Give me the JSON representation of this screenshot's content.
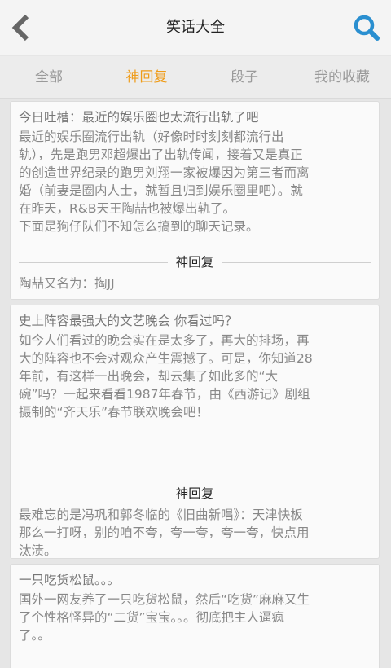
{
  "header": {
    "title": "笑话大全",
    "back_icon": "chevron-left-icon",
    "search_icon": "search-icon",
    "accent_color": "#2a8fd0"
  },
  "tabs": [
    {
      "label": "全部",
      "active": false
    },
    {
      "label": "神回复",
      "active": true
    },
    {
      "label": "段子",
      "active": false
    },
    {
      "label": "我的收藏",
      "active": false
    }
  ],
  "active_tab_color": "#ef9c19",
  "posts": [
    {
      "title": "今日吐槽：最近的娱乐圈也太流行出轨了吧",
      "body_lines": [
        "最近的娱乐圈流行出轨（好像时时刻刻都流行出",
        "轨），先是跑男邓超爆出了出轨传闻，接着又是真正",
        "的创造世界纪录的跑男刘翔一家被爆因为第三者而离",
        "婚（前妻是圈内人士，就暂且归到娱乐圈里吧）。就",
        "在昨天，R&B天王陶喆也被爆出轨了。",
        "下面是狗仔队们不知怎么搞到的聊天记录。"
      ],
      "divider_label": "神回复",
      "reply_lines": [
        "陶喆又名为：掏JJ"
      ]
    },
    {
      "title": "史上阵容最强大的文艺晚会 你看过吗？",
      "body_lines": [
        "如今人们看过的晚会实在是太多了，再大的排场，再",
        "大的阵容也不会对观众产生震撼了。可是，你知道28",
        "年前，有这样一出晚会，却云集了如此多的“大",
        "碗”吗？一起来看看1987年春节，由《西游记》剧组",
        "摄制的“齐天乐”春节联欢晚会吧！"
      ],
      "divider_label": "神回复",
      "reply_lines": [
        "最难忘的是冯巩和郭冬临的《旧曲新唱》：天津快板",
        "那么一打呀，别的咱不夸，夸一夸，夸一夸，快点用",
        "汰渍。"
      ]
    },
    {
      "title": "一只吃货松鼠。。。",
      "body_lines": [
        "国外一网友养了一只吃货松鼠，然后“吃货”麻麻又生",
        "了个性格怪异的“二货”宝宝。。。彻底把主人逼疯",
        "了。。"
      ]
    }
  ]
}
